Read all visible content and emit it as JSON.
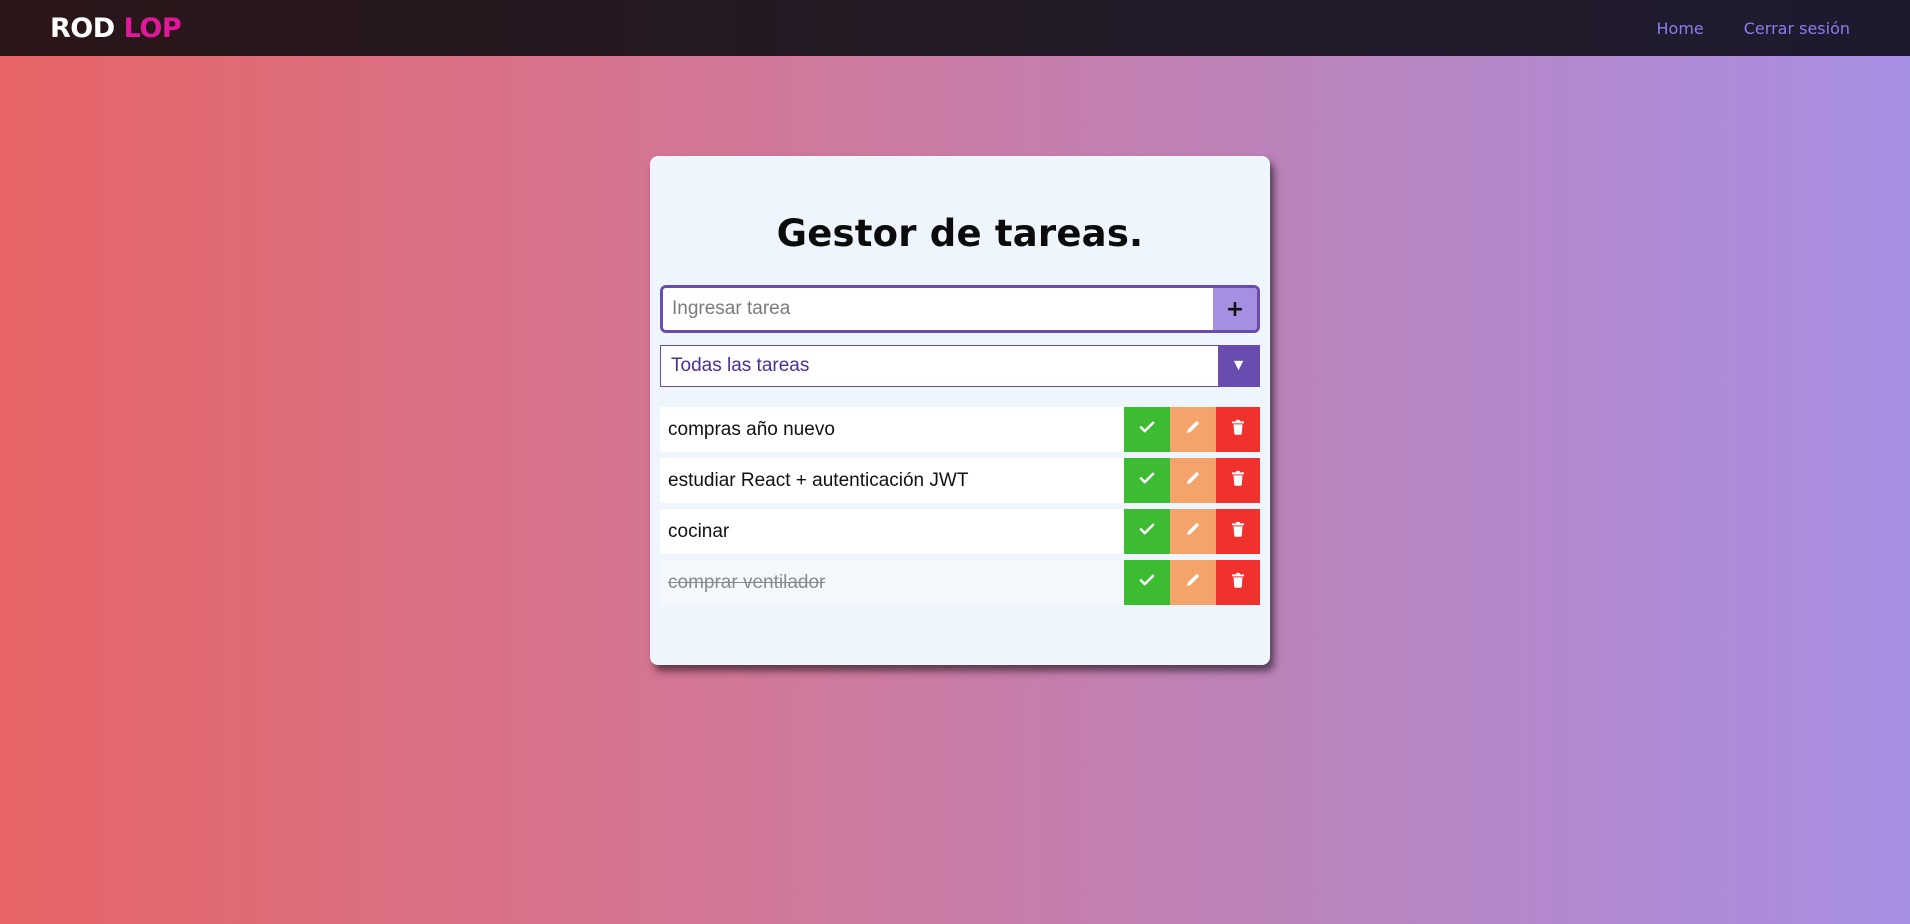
{
  "navbar": {
    "brand_first": "ROD",
    "brand_second": "LOP",
    "links": [
      "Home",
      "Cerrar sesión"
    ]
  },
  "main": {
    "title": "Gestor de tareas.",
    "input_placeholder": "Ingresar tarea",
    "add_button": "+",
    "filter_selected": "Todas las tareas",
    "filter_arrow": "▼",
    "tasks": [
      {
        "text": "compras año nuevo",
        "done": false
      },
      {
        "text": "estudiar React + autenticación JWT",
        "done": false
      },
      {
        "text": "cocinar",
        "done": false
      },
      {
        "text": "comprar ventilador",
        "done": true
      }
    ]
  },
  "icons": {
    "complete": "check-icon",
    "edit": "pencil-icon",
    "delete": "trash-icon"
  },
  "colors": {
    "brand_accent": "#e0189a",
    "nav_link": "#8d7cf0",
    "primary": "#6a4bb0",
    "add_button": "#a58fe3",
    "complete": "#3dbb33",
    "edit": "#f4a46a",
    "delete": "#f0312e"
  }
}
